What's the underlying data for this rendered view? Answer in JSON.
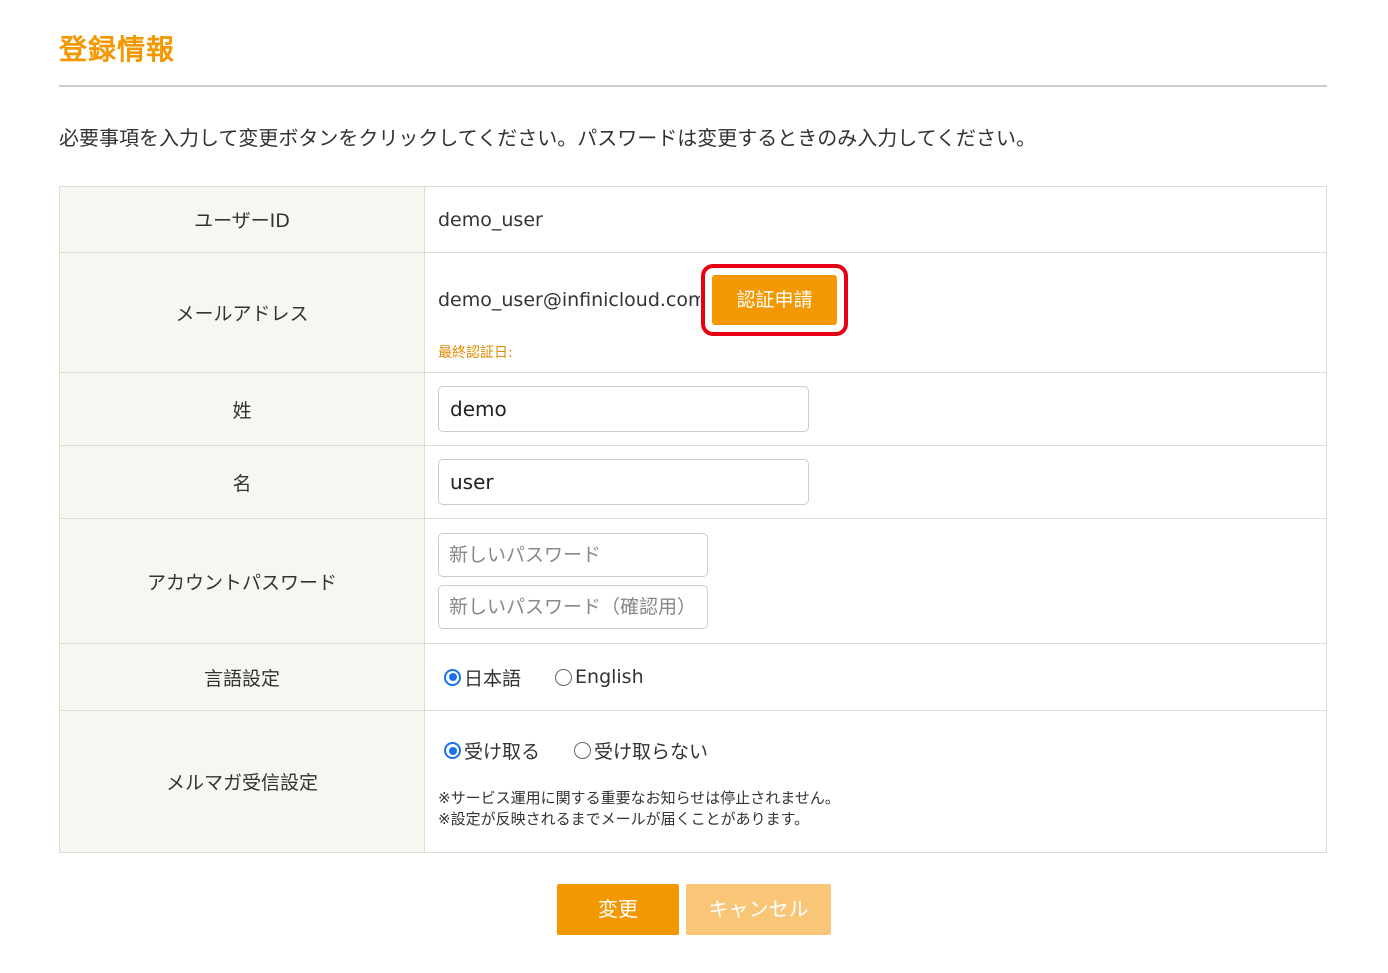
{
  "page": {
    "title": "登録情報",
    "instructions": "必要事項を入力して変更ボタンをクリックしてください。パスワードは変更するときのみ入力してください。"
  },
  "form": {
    "user_id": {
      "label": "ユーザーID",
      "value": "demo_user"
    },
    "email": {
      "label": "メールアドレス",
      "value": "demo_user@infinicloud.com",
      "verify_button": "認証申請",
      "last_verified_label": "最終認証日:"
    },
    "last_name": {
      "label": "姓",
      "value": "demo"
    },
    "first_name": {
      "label": "名",
      "value": "user"
    },
    "password": {
      "label": "アカウントパスワード",
      "new_placeholder": "新しいパスワード",
      "confirm_placeholder": "新しいパスワード（確認用）"
    },
    "language": {
      "label": "言語設定",
      "options": [
        "日本語",
        "English"
      ],
      "selected": "日本語"
    },
    "newsletter": {
      "label": "メルマガ受信設定",
      "options": [
        "受け取る",
        "受け取らない"
      ],
      "selected": "受け取る",
      "notes": [
        "※サービス運用に関する重要なお知らせは停止されません。",
        "※設定が反映されるまでメールが届くことがあります。"
      ]
    }
  },
  "actions": {
    "submit": "変更",
    "cancel": "キャンセル"
  },
  "colors": {
    "accent": "#f39800",
    "highlight_border": "#e60012",
    "cancel_disabled": "#f9c678",
    "radio_checked": "#1a73e8",
    "label_bg": "#f7f7f2"
  }
}
